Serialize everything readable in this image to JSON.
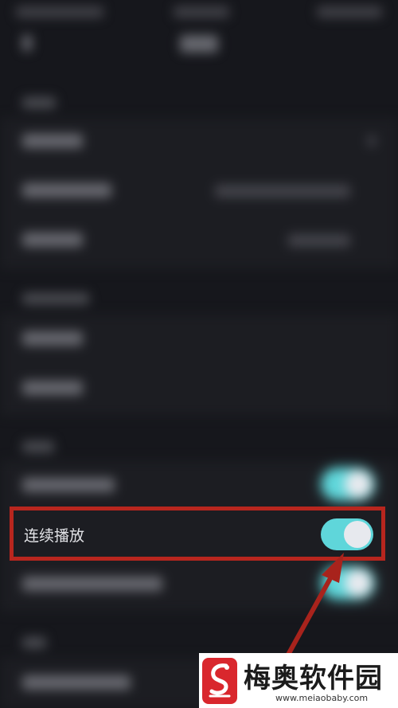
{
  "settings": {
    "rows": [
      {
        "label": "连续播放",
        "toggle_on": true
      }
    ]
  },
  "watermark": {
    "brand": "梅奥软件园",
    "url": "www.meiaobaby.com"
  },
  "colors": {
    "background": "#16171c",
    "row": "#1c1d22",
    "toggle_on": "#5fd6da",
    "highlight": "#b8261e",
    "logo": "#d9272d"
  }
}
